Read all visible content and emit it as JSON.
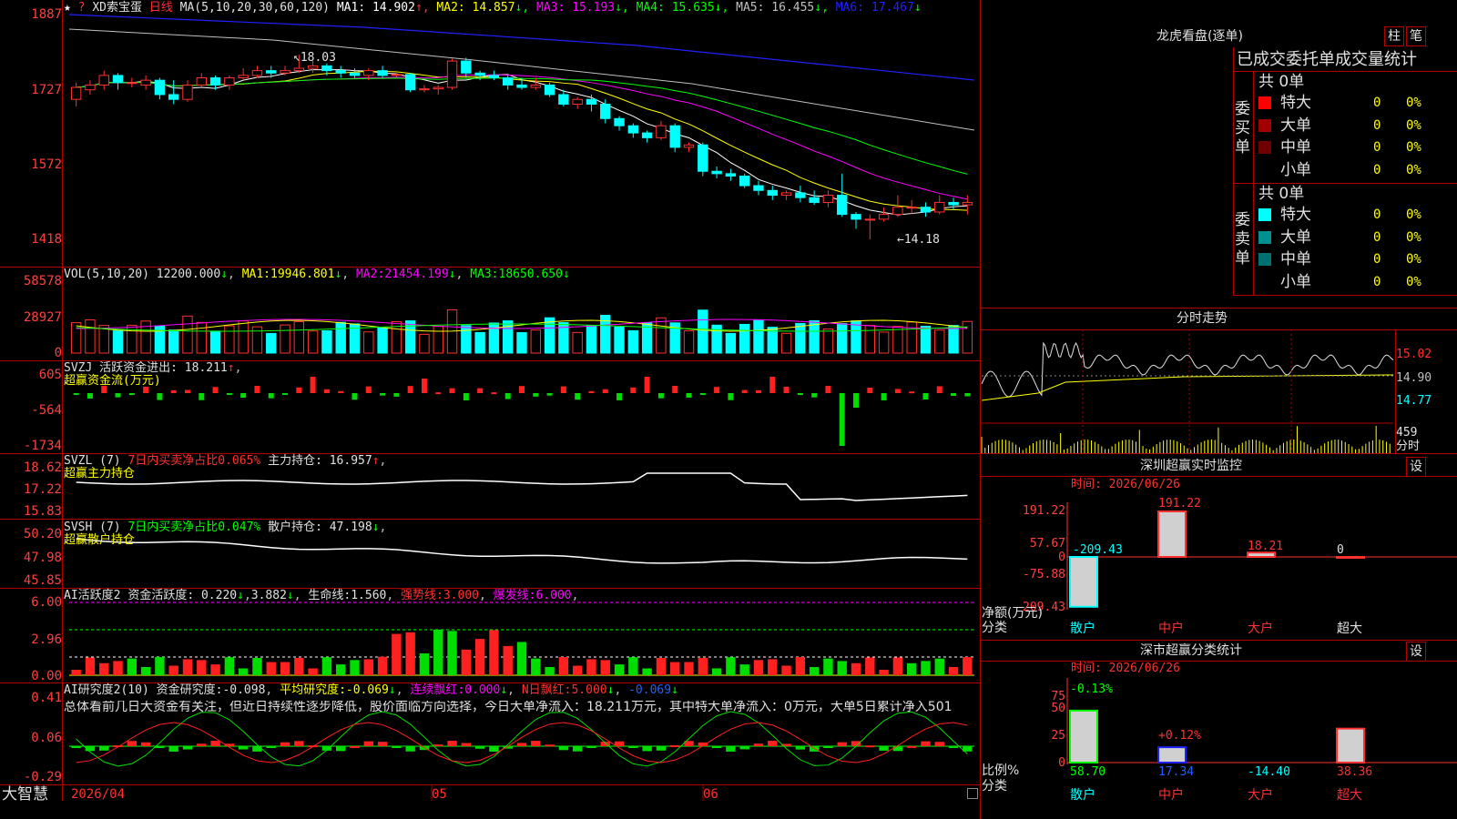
{
  "main": {
    "stock_name": "XD索宝蛋",
    "period": "日线",
    "ma_spec": "MA(5,10,20,30,60,120)",
    "ma_values": [
      {
        "label": "MA1:",
        "value": "14.902",
        "arrow": "↑",
        "color": "#ffffff"
      },
      {
        "label": "MA2:",
        "value": "14.857",
        "arrow": "↓",
        "color": "#ffff00"
      },
      {
        "label": "MA3:",
        "value": "15.193",
        "arrow": "↓",
        "color": "#ff00ff"
      },
      {
        "label": "MA4:",
        "value": "15.635",
        "arrow": "↓",
        "color": "#00ff00"
      },
      {
        "label": "MA5:",
        "value": "16.455",
        "arrow": "↓",
        "color": "#c0c0c0"
      },
      {
        "label": "MA6:",
        "value": "17.467",
        "arrow": "↓",
        "color": "#2020ff"
      }
    ],
    "y_labels": [
      "1887",
      "1727",
      "1572",
      "1418"
    ],
    "high_marker": "18.03",
    "low_marker": "14.18",
    "ohlc": [
      [
        17.1,
        17.35,
        17.45,
        16.95
      ],
      [
        17.3,
        17.4,
        17.5,
        17.2
      ],
      [
        17.4,
        17.6,
        17.7,
        17.3
      ],
      [
        17.6,
        17.45,
        17.65,
        17.3
      ],
      [
        17.45,
        17.45,
        17.55,
        17.35
      ],
      [
        17.4,
        17.5,
        17.6,
        17.3
      ],
      [
        17.5,
        17.2,
        17.55,
        17.1
      ],
      [
        17.2,
        17.1,
        17.5,
        17.0
      ],
      [
        17.1,
        17.4,
        17.5,
        17.05
      ],
      [
        17.4,
        17.55,
        17.65,
        17.35
      ],
      [
        17.55,
        17.4,
        17.6,
        17.3
      ],
      [
        17.4,
        17.55,
        17.6,
        17.3
      ],
      [
        17.55,
        17.6,
        17.75,
        17.5
      ],
      [
        17.6,
        17.7,
        17.8,
        17.55
      ],
      [
        17.7,
        17.65,
        17.8,
        17.55
      ],
      [
        17.65,
        17.7,
        17.8,
        17.6
      ],
      [
        17.7,
        17.75,
        18.03,
        17.65
      ],
      [
        17.75,
        17.8,
        17.9,
        17.65
      ],
      [
        17.8,
        17.7,
        17.85,
        17.6
      ],
      [
        17.7,
        17.65,
        17.8,
        17.55
      ],
      [
        17.65,
        17.6,
        17.75,
        17.55
      ],
      [
        17.6,
        17.7,
        17.75,
        17.5
      ],
      [
        17.7,
        17.6,
        17.8,
        17.55
      ],
      [
        17.6,
        17.62,
        17.7,
        17.55
      ],
      [
        17.62,
        17.3,
        17.65,
        17.25
      ],
      [
        17.3,
        17.32,
        17.4,
        17.25
      ],
      [
        17.32,
        17.35,
        17.4,
        17.2
      ],
      [
        17.35,
        17.9,
        17.95,
        17.3
      ],
      [
        17.9,
        17.65,
        17.97,
        17.55
      ],
      [
        17.65,
        17.6,
        17.7,
        17.5
      ],
      [
        17.6,
        17.55,
        17.7,
        17.5
      ],
      [
        17.55,
        17.4,
        17.6,
        17.3
      ],
      [
        17.4,
        17.35,
        17.55,
        17.3
      ],
      [
        17.35,
        17.4,
        17.55,
        17.3
      ],
      [
        17.4,
        17.2,
        17.45,
        17.15
      ],
      [
        17.2,
        17.0,
        17.3,
        16.95
      ],
      [
        17.0,
        17.1,
        17.15,
        16.9
      ],
      [
        17.1,
        17.0,
        17.2,
        16.85
      ],
      [
        17.0,
        16.7,
        17.1,
        16.6
      ],
      [
        16.7,
        16.55,
        16.75,
        16.45
      ],
      [
        16.55,
        16.4,
        16.6,
        16.3
      ],
      [
        16.4,
        16.3,
        16.45,
        16.2
      ],
      [
        16.3,
        16.55,
        16.65,
        16.25
      ],
      [
        16.55,
        16.1,
        16.6,
        16.0
      ],
      [
        16.1,
        16.15,
        16.2,
        16.0
      ],
      [
        16.15,
        15.6,
        16.2,
        15.5
      ],
      [
        15.6,
        15.55,
        15.7,
        15.45
      ],
      [
        15.55,
        15.5,
        15.65,
        15.4
      ],
      [
        15.5,
        15.3,
        15.55,
        15.25
      ],
      [
        15.3,
        15.2,
        15.4,
        15.1
      ],
      [
        15.2,
        15.1,
        15.3,
        15.0
      ],
      [
        15.1,
        15.15,
        15.2,
        15.0
      ],
      [
        15.15,
        15.05,
        15.3,
        14.95
      ],
      [
        15.05,
        14.95,
        15.2,
        14.9
      ],
      [
        14.95,
        15.1,
        15.2,
        14.85
      ],
      [
        15.1,
        14.7,
        15.55,
        14.65
      ],
      [
        14.7,
        14.6,
        14.75,
        14.4
      ],
      [
        14.6,
        14.6,
        14.7,
        14.18
      ],
      [
        14.6,
        14.7,
        14.85,
        14.55
      ],
      [
        14.7,
        14.85,
        15.1,
        14.65
      ],
      [
        14.85,
        14.85,
        15.0,
        14.7
      ],
      [
        14.85,
        14.75,
        14.95,
        14.65
      ],
      [
        14.75,
        14.95,
        15.1,
        14.7
      ],
      [
        14.95,
        14.9,
        15.05,
        14.8
      ],
      [
        14.9,
        14.95,
        15.1,
        14.7
      ]
    ]
  },
  "vol": {
    "header": "VOL(5,10,20)",
    "value": "12200.000",
    "ma1": "MA1:",
    "ma1v": "19946.801",
    "ma2": "MA2:",
    "ma2v": "21454.199",
    "ma3": "MA3:",
    "ma3v": "18650.650",
    "y_labels": [
      "58578",
      "28927",
      "0"
    ]
  },
  "svzj": {
    "header": "SVZJ",
    "label": "活跃资金进出:",
    "value": "18.211",
    "sub": "超赢资金流(万元)",
    "y_labels": [
      "605",
      "-564",
      "-1734"
    ]
  },
  "svzl": {
    "header": "SVZL (7)",
    "pct": "7日内买卖净占比0.065%",
    "label": "主力持仓:",
    "value": "16.957",
    "sub": "超赢主力持仓",
    "y_labels": [
      "18.62",
      "17.22",
      "15.83"
    ]
  },
  "svsh": {
    "header": "SVSH (7)",
    "pct": "7日内买卖净占比0.047%",
    "label": "散户持仓:",
    "value": "47.198",
    "sub": "超赢散户持仓",
    "y_labels": [
      "50.20",
      "47.98",
      "45.85"
    ]
  },
  "ai1": {
    "header": "AI活跃度2",
    "l1": "资金活跃度:",
    "v1": "0.220",
    "v2": "3.882",
    "l3": "生命线:",
    "v3": "1.560",
    "l4": "强势线:",
    "v4": "3.000",
    "l5": "爆发线:",
    "v5": "6.000",
    "y_labels": [
      "6.00",
      "2.96",
      "0.00"
    ]
  },
  "ai2": {
    "header": "AI研究度2(10)",
    "l1": "资金研究度:",
    "v1": "-0.098",
    "l2": "平均研究度:",
    "v2": "-0.069",
    "l3": "连续飘红:",
    "v3": "0.000",
    "l4": "N日飘红:",
    "v4": "5.000",
    "v5": "-0.069",
    "summary": "总体看前几日大资金有关注，但近日持续性逐步降低，股价面临方向选择，今日大单净流入：18.211万元，其中特大单净流入：0万元，大单5日累计净入501",
    "y_labels": [
      "0.41",
      "0.06",
      "-0.29"
    ]
  },
  "footer": {
    "brand": "大智慧",
    "date_labels": [
      "2026/04",
      "05",
      "06"
    ]
  },
  "right": {
    "title": "龙虎看盘(逐单)",
    "btn1": "柱",
    "btn2": "笔",
    "section": "已成交委托单成交量统计",
    "buy_title": "委买单",
    "sell_title": "委卖单",
    "buy_total": "共 0单",
    "sell_total": "共 0单",
    "buy_rows": [
      {
        "name": "特大",
        "count": "0",
        "pct": "0%",
        "color": "#ff0000"
      },
      {
        "name": "大单",
        "count": "0",
        "pct": "0%",
        "color": "#a00000"
      },
      {
        "name": "中单",
        "count": "0",
        "pct": "0%",
        "color": "#700000"
      },
      {
        "name": "小单",
        "count": "0",
        "pct": "0%",
        "color": "#000000"
      }
    ],
    "sell_rows": [
      {
        "name": "特大",
        "count": "0",
        "pct": "0%",
        "color": "#00ffff"
      },
      {
        "name": "大单",
        "count": "0",
        "pct": "0%",
        "color": "#009090"
      },
      {
        "name": "中单",
        "count": "0",
        "pct": "0%",
        "color": "#007070"
      },
      {
        "name": "小单",
        "count": "0",
        "pct": "0%",
        "color": "#000000"
      }
    ],
    "intraday_title": "分时走势",
    "intraday_y": [
      "15.02",
      "14.90",
      "14.77"
    ],
    "intraday_vol": "459",
    "intraday_vol_unit": "分时",
    "monitor_title": "深圳超赢实时监控",
    "monitor_btn": "设",
    "monitor_time": "时间: 2026/06/26",
    "monitor_y": [
      "191.22",
      "57.67",
      "0",
      "-75.88",
      "-209.43"
    ],
    "monitor_values": [
      {
        "cat": "散户",
        "value": "-209.43"
      },
      {
        "cat": "中户",
        "value": "191.22"
      },
      {
        "cat": "大户",
        "value": "18.21"
      },
      {
        "cat": "超大",
        "value": "0"
      }
    ],
    "monitor_axis_label": "净额(万元)",
    "monitor_cat_label": "分类",
    "class_title": "深市超赢分类统计",
    "class_btn": "设",
    "class_time": "时间: 2026/06/26",
    "class_y": [
      "75",
      "50",
      "25",
      "0"
    ],
    "class_values": [
      {
        "cat": "散户",
        "pct": "-0.13%",
        "value": "58.70"
      },
      {
        "cat": "中户",
        "pct": "+0.12%",
        "value": "17.34"
      },
      {
        "cat": "大户",
        "pct": "",
        "value": "-14.40"
      },
      {
        "cat": "超大",
        "pct": "",
        "value": "38.36"
      }
    ],
    "class_axis_label": "比例%",
    "class_cat_label": "分类"
  },
  "chart_data": {
    "type": "table",
    "title": "",
    "monitor_net_amount": {
      "categories": [
        "散户",
        "中户",
        "大户",
        "超大"
      ],
      "values": [
        -209.43,
        191.22,
        18.21,
        0
      ]
    },
    "class_ratio": {
      "categories": [
        "散户",
        "中户",
        "大户",
        "超大"
      ],
      "values": [
        58.7,
        17.34,
        -14.4,
        38.36
      ]
    }
  },
  "colors": {
    "up": "#ff3030",
    "down": "#00ffff",
    "grid": "#b00000",
    "axis_text": "#ff4040"
  }
}
